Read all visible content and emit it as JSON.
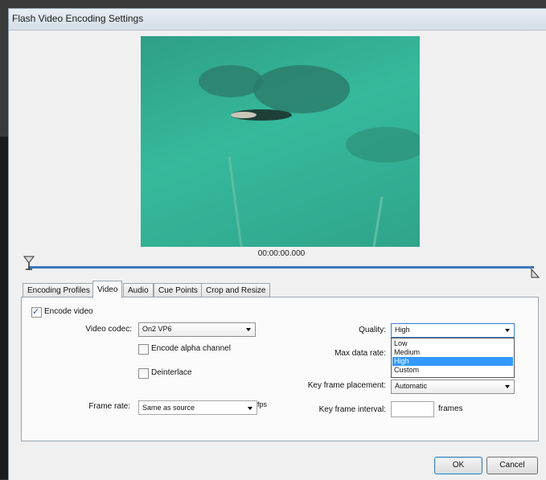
{
  "window": {
    "title": "Flash Video Encoding Settings"
  },
  "preview": {
    "timecode": "00:00:00.000"
  },
  "tabs": [
    {
      "label": "Encoding Profiles",
      "active": false
    },
    {
      "label": "Video",
      "active": true
    },
    {
      "label": "Audio",
      "active": false
    },
    {
      "label": "Cue Points",
      "active": false
    },
    {
      "label": "Crop and Resize",
      "active": false
    }
  ],
  "video": {
    "encode_video": {
      "label": "Encode video",
      "checked": true
    },
    "codec": {
      "label": "Video codec:",
      "value": "On2 VP6"
    },
    "alpha": {
      "label": "Encode alpha channel",
      "checked": false
    },
    "deinterlace": {
      "label": "Deinterlace",
      "checked": false
    },
    "frame_rate": {
      "label": "Frame rate:",
      "value": "Same as source",
      "unit": "fps"
    },
    "quality": {
      "label": "Quality:",
      "value": "High",
      "options": [
        "Low",
        "Medium",
        "High",
        "Custom"
      ],
      "selected_index": 2
    },
    "max_data_rate": {
      "label": "Max data rate:"
    },
    "key_frame_placement": {
      "label": "Key frame placement:",
      "value": "Automatic"
    },
    "key_frame_interval": {
      "label": "Key frame interval:",
      "value": "",
      "unit": "frames"
    }
  },
  "buttons": {
    "ok": "OK",
    "cancel": "Cancel"
  },
  "colors": {
    "accent": "#3399ff",
    "water": "#34b095",
    "scrub": "#3b78b8"
  }
}
